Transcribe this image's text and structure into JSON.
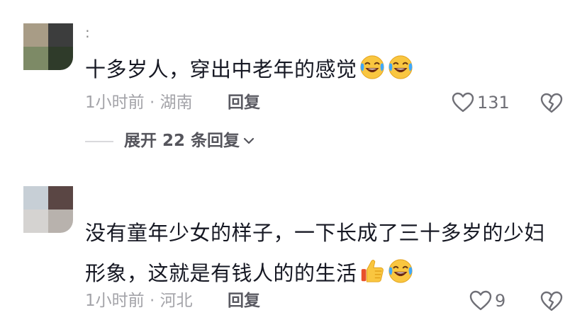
{
  "comments": [
    {
      "username": ":",
      "text": "十多岁人，穿出中老年的感觉",
      "emojis": [
        "laugh-cry-emoji",
        "laugh-cry-emoji"
      ],
      "time": "1小时前",
      "separator": "·",
      "location": "湖南",
      "reply_label": "回复",
      "likes": "131",
      "expand_label": "展开 22 条回复",
      "avatar_colors": [
        "#a89c86",
        "#3c3d3d",
        "#7d8a66",
        "#2f3b2a"
      ]
    },
    {
      "username": "",
      "text_line1": "没有童年少女的样子，一下长成了三十多岁的少妇",
      "text_line2": "形象，这就是有钱人的的生活",
      "emojis": [
        "thumbs-up-emoji",
        "laugh-cry-emoji"
      ],
      "time": "1小时前",
      "separator": "·",
      "location": "河北",
      "reply_label": "回复",
      "likes": "9",
      "avatar_colors": [
        "#c7cfd6",
        "#5a4644",
        "#d5d3d1",
        "#b8b2ad"
      ]
    }
  ],
  "icons": {
    "like": "heart-outline-icon",
    "dislike": "broken-heart-icon",
    "expand": "chevron-down-icon"
  },
  "colors": {
    "text_primary": "#161823",
    "text_meta": "#a3a3a8",
    "icon": "#6f6f76"
  }
}
